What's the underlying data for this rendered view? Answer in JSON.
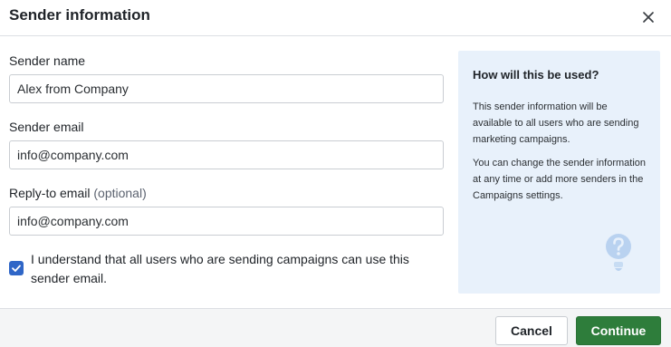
{
  "dialog": {
    "title": "Sender information",
    "close_icon": "close-icon"
  },
  "form": {
    "sender_name": {
      "label": "Sender name",
      "value": "Alex from Company"
    },
    "sender_email": {
      "label": "Sender email",
      "value": "info@company.com"
    },
    "reply_to": {
      "label": "Reply-to email",
      "optional": "(optional)",
      "value": "info@company.com"
    },
    "consent": {
      "checked": true,
      "text": "I understand that all users who are sending campaigns can use this sender email."
    }
  },
  "info": {
    "title": "How will this be used?",
    "paragraph1": "This sender information will be available to all users who are sending marketing campaigns.",
    "paragraph2": "You can change the sender information at any time or add more senders in the Campaigns settings.",
    "icon": "question-bubble-icon"
  },
  "footer": {
    "cancel_label": "Cancel",
    "continue_label": "Continue"
  },
  "colors": {
    "primary": "#2e7d3b",
    "checkbox": "#2f66c7",
    "info_panel": "#e8f1fb"
  }
}
